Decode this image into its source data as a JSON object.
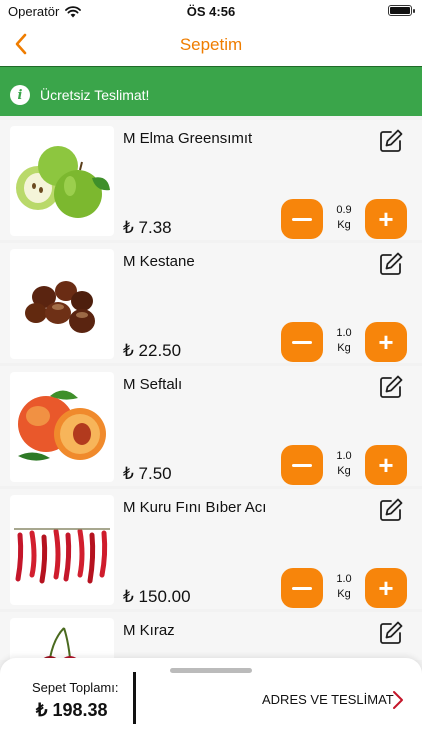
{
  "status_bar": {
    "carrier": "Operatör",
    "time": "ÖS 4:56"
  },
  "nav": {
    "title": "Sepetim"
  },
  "banner": {
    "text": "Ücretsiz Teslimat!"
  },
  "items": [
    {
      "name": "M Elma Greensımıt",
      "price": "₺ 7.38",
      "qty": "0.9",
      "unit": "Kg",
      "image": "green-apple-image"
    },
    {
      "name": "M Kestane",
      "price": "₺ 22.50",
      "qty": "1.0",
      "unit": "Kg",
      "image": "chestnut-image"
    },
    {
      "name": "M Seftalı",
      "price": "₺ 7.50",
      "qty": "1.0",
      "unit": "Kg",
      "image": "peach-image"
    },
    {
      "name": "M Kuru Fını Bıber Acı",
      "price": "₺ 150.00",
      "qty": "1.0",
      "unit": "Kg",
      "image": "dried-chili-image"
    },
    {
      "name": "M Kıraz",
      "price": "",
      "qty": "",
      "unit": "",
      "image": "cherry-image"
    }
  ],
  "cart": {
    "total_label": "Sepet Toplamı:",
    "total_value": "₺ 198.38",
    "checkout_label": "ADRES VE TESLİMAT"
  },
  "colors": {
    "accent": "#f7850b",
    "title": "#ef7d00",
    "banner": "#3aa54a"
  }
}
